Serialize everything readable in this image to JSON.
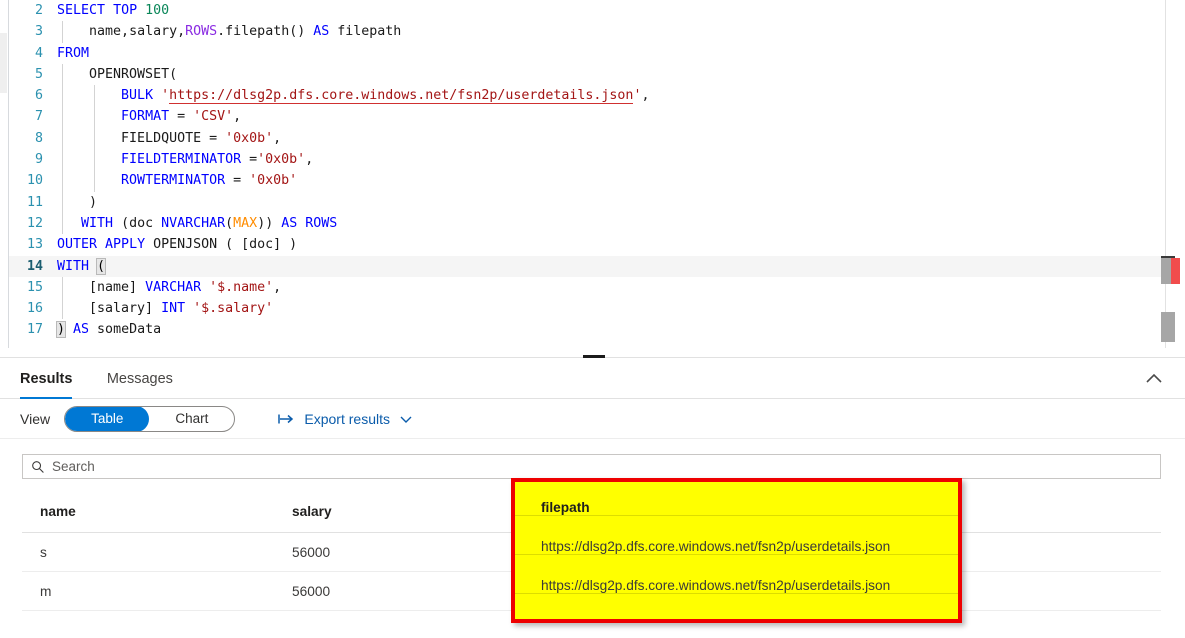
{
  "editor": {
    "lines": [
      {
        "num": "2",
        "active": false,
        "indent": 0,
        "tokens": [
          {
            "t": "SELECT",
            "c": "kw"
          },
          {
            "t": " ",
            "c": "pln"
          },
          {
            "t": "TOP",
            "c": "kw"
          },
          {
            "t": " ",
            "c": "pln"
          },
          {
            "t": "100",
            "c": "num"
          }
        ]
      },
      {
        "num": "3",
        "active": false,
        "indent": 1,
        "tokens": [
          {
            "t": "    name",
            "c": "pln"
          },
          {
            "t": ",",
            "c": "pln"
          },
          {
            "t": "salary",
            "c": "pln"
          },
          {
            "t": ",",
            "c": "pln"
          },
          {
            "t": "ROWS",
            "c": "fn"
          },
          {
            "t": ".filepath() ",
            "c": "pln"
          },
          {
            "t": "AS",
            "c": "kw"
          },
          {
            "t": " filepath",
            "c": "pln"
          }
        ]
      },
      {
        "num": "4",
        "active": false,
        "indent": 0,
        "tokens": [
          {
            "t": "FROM",
            "c": "kw"
          }
        ]
      },
      {
        "num": "5",
        "active": false,
        "indent": 1,
        "tokens": [
          {
            "t": "    OPENROWSET(",
            "c": "pln"
          }
        ]
      },
      {
        "num": "6",
        "active": false,
        "indent": 2,
        "tokens": [
          {
            "t": "        ",
            "c": "pln"
          },
          {
            "t": "BULK",
            "c": "kw"
          },
          {
            "t": " ",
            "c": "pln"
          },
          {
            "t": "'",
            "c": "str"
          },
          {
            "t": "https://dlsg2p.dfs.core.windows.net/fsn2p/userdetails.json",
            "c": "url-err"
          },
          {
            "t": "'",
            "c": "str"
          },
          {
            "t": ",",
            "c": "pln"
          }
        ]
      },
      {
        "num": "7",
        "active": false,
        "indent": 2,
        "tokens": [
          {
            "t": "        ",
            "c": "pln"
          },
          {
            "t": "FORMAT",
            "c": "kw"
          },
          {
            "t": " = ",
            "c": "pln"
          },
          {
            "t": "'CSV'",
            "c": "str"
          },
          {
            "t": ",",
            "c": "pln"
          }
        ]
      },
      {
        "num": "8",
        "active": false,
        "indent": 2,
        "tokens": [
          {
            "t": "        FIELDQUOTE = ",
            "c": "pln"
          },
          {
            "t": "'0x0b'",
            "c": "str"
          },
          {
            "t": ",",
            "c": "pln"
          }
        ]
      },
      {
        "num": "9",
        "active": false,
        "indent": 2,
        "tokens": [
          {
            "t": "        ",
            "c": "pln"
          },
          {
            "t": "FIELDTERMINATOR",
            "c": "kw"
          },
          {
            "t": " =",
            "c": "pln"
          },
          {
            "t": "'0x0b'",
            "c": "str"
          },
          {
            "t": ",",
            "c": "pln"
          }
        ]
      },
      {
        "num": "10",
        "active": false,
        "indent": 2,
        "tokens": [
          {
            "t": "        ",
            "c": "pln"
          },
          {
            "t": "ROWTERMINATOR",
            "c": "kw"
          },
          {
            "t": " = ",
            "c": "pln"
          },
          {
            "t": "'0x0b'",
            "c": "str"
          }
        ]
      },
      {
        "num": "11",
        "active": false,
        "indent": 1,
        "tokens": [
          {
            "t": "    )",
            "c": "pln"
          }
        ]
      },
      {
        "num": "12",
        "active": false,
        "indent": 1,
        "tokens": [
          {
            "t": "   ",
            "c": "pln"
          },
          {
            "t": "WITH",
            "c": "kw"
          },
          {
            "t": " (doc ",
            "c": "pln"
          },
          {
            "t": "NVARCHAR",
            "c": "kw"
          },
          {
            "t": "(",
            "c": "pln"
          },
          {
            "t": "MAX",
            "c": "typ"
          },
          {
            "t": ")) ",
            "c": "pln"
          },
          {
            "t": "AS",
            "c": "kw"
          },
          {
            "t": " ",
            "c": "pln"
          },
          {
            "t": "ROWS",
            "c": "kw"
          }
        ]
      },
      {
        "num": "13",
        "active": false,
        "indent": 0,
        "tokens": [
          {
            "t": "OUTER",
            "c": "kw"
          },
          {
            "t": " ",
            "c": "pln"
          },
          {
            "t": "APPLY",
            "c": "kw"
          },
          {
            "t": " OPENJSON ( [doc] )",
            "c": "pln"
          }
        ]
      },
      {
        "num": "14",
        "active": true,
        "indent": 0,
        "tokens": [
          {
            "t": "WITH",
            "c": "kw"
          },
          {
            "t": " ",
            "c": "pln"
          },
          {
            "t": "(",
            "c": "bracket-match"
          }
        ]
      },
      {
        "num": "15",
        "active": false,
        "indent": 1,
        "tokens": [
          {
            "t": "    [name] ",
            "c": "pln"
          },
          {
            "t": "VARCHAR",
            "c": "kw"
          },
          {
            "t": " ",
            "c": "pln"
          },
          {
            "t": "'$.name'",
            "c": "str"
          },
          {
            "t": ",",
            "c": "pln"
          }
        ]
      },
      {
        "num": "16",
        "active": false,
        "indent": 1,
        "tokens": [
          {
            "t": "    [salary] ",
            "c": "pln"
          },
          {
            "t": "INT",
            "c": "kw"
          },
          {
            "t": " ",
            "c": "pln"
          },
          {
            "t": "'$.salary'",
            "c": "str"
          }
        ]
      },
      {
        "num": "17",
        "active": false,
        "indent": 0,
        "tokens": [
          {
            "t": ")",
            "c": "bracket-match"
          },
          {
            "t": " ",
            "c": "pln"
          },
          {
            "t": "AS",
            "c": "kw"
          },
          {
            "t": " someData",
            "c": "pln"
          }
        ]
      }
    ]
  },
  "results": {
    "tabs": [
      {
        "label": "Results",
        "active": true
      },
      {
        "label": "Messages",
        "active": false
      }
    ],
    "collapse_icon": "chevron-up-icon",
    "toolbar": {
      "view_label": "View",
      "view_options": [
        {
          "label": "Table",
          "selected": true
        },
        {
          "label": "Chart",
          "selected": false
        }
      ],
      "export_label": "Export results",
      "export_icon": "export-arrow-icon",
      "export_chevron": "chevron-down-icon"
    },
    "search": {
      "placeholder": "Search",
      "value": "",
      "icon": "search-icon"
    },
    "table": {
      "columns": [
        "name",
        "salary",
        "filepath"
      ],
      "rows": [
        {
          "name": "s",
          "salary": "56000",
          "filepath": "https://dlsg2p.dfs.core.windows.net/fsn2p/userdetails.json"
        },
        {
          "name": "m",
          "salary": "56000",
          "filepath": "https://dlsg2p.dfs.core.windows.net/fsn2p/userdetails.json"
        }
      ]
    }
  },
  "annotation": {
    "header": "filepath",
    "row1": "https://dlsg2p.dfs.core.windows.net/fsn2p/userdetails.json",
    "row2": "https://dlsg2p.dfs.core.windows.net/fsn2p/userdetails.json",
    "highlight_color": "#ffff00",
    "border_color": "#ee0000"
  },
  "colors": {
    "accent": "#0078d4",
    "keyword": "#0000ff",
    "string": "#a31515",
    "number": "#098658",
    "function": "#8a2be2",
    "type": "#ff8c00",
    "linenumber": "#2b91af",
    "error": "#f14c4c"
  }
}
